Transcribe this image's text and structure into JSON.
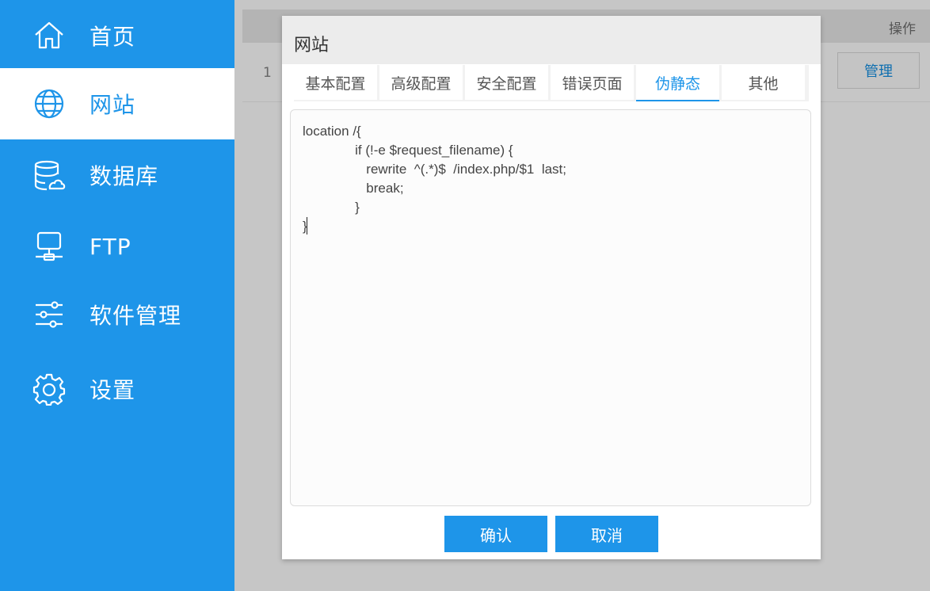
{
  "sidebar": {
    "items": [
      {
        "label": "首页",
        "icon": "home-icon"
      },
      {
        "label": "网站",
        "icon": "globe-icon",
        "active": true
      },
      {
        "label": "数据库",
        "icon": "database-icon"
      },
      {
        "label": "FTP",
        "icon": "server-icon"
      },
      {
        "label": "软件管理",
        "icon": "sliders-icon"
      },
      {
        "label": "设置",
        "icon": "gear-icon"
      }
    ],
    "accent_color": "#1e95e9"
  },
  "table": {
    "op_header": "操作",
    "rows": [
      {
        "num": "1",
        "action": "管理"
      }
    ]
  },
  "modal": {
    "title": "网站",
    "tabs": [
      "基本配置",
      "高级配置",
      "安全配置",
      "错误页面",
      "伪静态",
      "其他"
    ],
    "active_tab": "伪静态",
    "editor_content": "location /{\n              if (!-e $request_filename) {\n                 rewrite  ^(.*)$  /index.php/$1  last;\n                 break;\n              }\n}",
    "confirm_label": "确认",
    "cancel_label": "取消"
  }
}
